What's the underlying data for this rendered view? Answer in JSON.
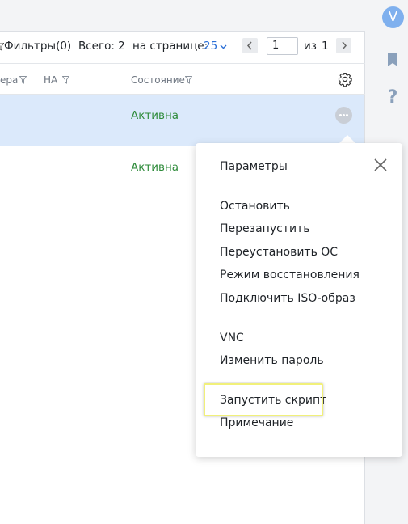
{
  "toolbar": {
    "filters": "Фильтры(0)",
    "total": "Всего: 2",
    "per_page_label": "на странице:",
    "per_page_value": "25",
    "page_value": "1",
    "of_label": "из",
    "total_pages": "1"
  },
  "table": {
    "columns": [
      {
        "label": "ера"
      },
      {
        "label": "НА"
      },
      {
        "label": "Состояние"
      }
    ],
    "rows": [
      {
        "status": "Активна",
        "selected": true
      },
      {
        "status": "Активна",
        "selected": false
      }
    ]
  },
  "user": {
    "avatar_letter": "V"
  },
  "sidebar_icons": [
    "bookmark-icon",
    "help-icon"
  ],
  "context_menu": {
    "items": [
      "Параметры",
      "Остановить",
      "Перезапустить",
      "Переустановить ОС",
      "Режим восстановления",
      "Подключить ISO-образ",
      "VNC",
      "Изменить пароль",
      "Запустить скрипт",
      "Примечание"
    ],
    "highlighted_index": 8
  },
  "colors": {
    "accent": "#2b6fd6",
    "status_active": "#2e8b3a",
    "selected_row": "#dbe9fb",
    "highlight_border": "#f1f07a"
  }
}
